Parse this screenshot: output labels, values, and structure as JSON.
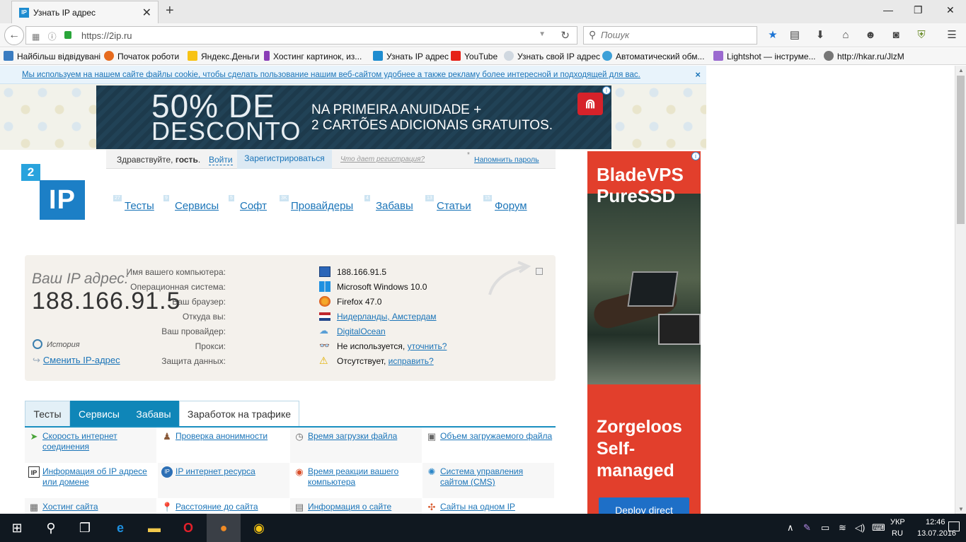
{
  "browser": {
    "tab_title": "Узнать IP адрес",
    "tab_favicon": "IP",
    "url": "https://2ip.ru",
    "search_placeholder": "Пошук",
    "bookmarks": [
      {
        "label": "Найбільш відвідувані",
        "icon": "most-visited-icon"
      },
      {
        "label": "Початок роботи",
        "icon": "firefox-icon"
      },
      {
        "label": "Яндекс.Деньги",
        "icon": "yandex-money-icon"
      },
      {
        "label": "Хостинг картинок, из...",
        "icon": "k-icon"
      },
      {
        "label": "Узнать IP адрес",
        "icon": "ip-icon"
      },
      {
        "label": "YouTube",
        "icon": "youtube-icon"
      },
      {
        "label": "Узнать свой IP адрес",
        "icon": "search-icon"
      },
      {
        "label": "Автоматический обм...",
        "icon": "exchange-icon"
      },
      {
        "label": "Lightshot — інструме...",
        "icon": "feather-icon"
      },
      {
        "label": "http://hkar.ru/JlzM",
        "icon": "globe-icon"
      }
    ]
  },
  "cookie": {
    "text": "Мы используем на нашем сайте файлы cookie, чтобы сделать пользование нашим веб-сайтом удобнее а также рекламу более интересной и подходящей для вас.",
    "close": "×"
  },
  "banner": {
    "line1": "50% DE",
    "line2": "DESCONTO",
    "text1": "NA PRIMEIRA ANUIDADE +",
    "text2": "2 CARTÕES ADICIONAIS GRATUITOS."
  },
  "login": {
    "greeting": "Здравствуйте,",
    "guest": "гость",
    "login": "Войти",
    "register": "Зарегистрироваться",
    "what": "Что дает регистрация?",
    "star": "*",
    "remind": "Напомнить пароль"
  },
  "logo": {
    "top": "2",
    "main": "IP"
  },
  "nav": [
    {
      "count": "27",
      "label": "Тесты"
    },
    {
      "count": "9",
      "label": "Сервисы"
    },
    {
      "count": "5",
      "label": "Софт"
    },
    {
      "count": "3K",
      "label": "Провайдеры"
    },
    {
      "count": "4",
      "label": "Забавы"
    },
    {
      "count": "13",
      "label": "Статьи"
    },
    {
      "count": "15",
      "label": "Форум"
    }
  ],
  "ipinfo": {
    "caption": "Ваш IP адрес:",
    "ip": "188.166.91.5",
    "history": "История",
    "change": "Сменить IP-адрес",
    "rows": [
      {
        "key": "Имя вашего компьютера:",
        "value": "188.166.91.5",
        "icon": "computer-icon"
      },
      {
        "key": "Операционная система:",
        "value": "Microsoft Windows 10.0",
        "icon": "windows-icon"
      },
      {
        "key": "Ваш браузер:",
        "value": "Firefox 47.0",
        "icon": "firefox-icon"
      },
      {
        "key": "Откуда вы:",
        "value": "Нидерланды, Амстердам",
        "icon": "netherlands-flag-icon"
      },
      {
        "key": "Ваш провайдер:",
        "value": "DigitalOcean",
        "icon": "cloud-icon"
      },
      {
        "key": "Прокси:",
        "value": "Не используется,",
        "extra": "уточнить?",
        "icon": "glasses-icon"
      },
      {
        "key": "Защита данных:",
        "value": "Отсутствует,",
        "extra": "исправить?",
        "icon": "warning-icon"
      }
    ]
  },
  "tabs": [
    "Тесты",
    "Сервисы",
    "Забавы",
    "Заработок на трафике"
  ],
  "services": [
    {
      "label": "Скорость интернет соединения",
      "icon": "speed-icon"
    },
    {
      "label": "Проверка анонимности",
      "icon": "spy-icon"
    },
    {
      "label": "Время загрузки файла",
      "icon": "clock-icon"
    },
    {
      "label": "Объем загружаемого файла",
      "icon": "file-size-icon"
    },
    {
      "label": "Информация об IP адресе или домене",
      "icon": "ip-info-icon"
    },
    {
      "label": "IP интернет ресурса",
      "icon": "ip-globe-icon"
    },
    {
      "label": "Время реакции вашего компьютера",
      "icon": "ping-icon"
    },
    {
      "label": "Система управления сайтом (CMS)",
      "icon": "cms-icon"
    },
    {
      "label": "Хостинг сайта",
      "icon": "hosting-icon"
    },
    {
      "label": "Расстояние до сайта",
      "icon": "location-pin-icon"
    },
    {
      "label": "Информация о сайте",
      "icon": "site-info-icon"
    },
    {
      "label": "Сайты на одном IP",
      "icon": "sites-icon"
    }
  ],
  "sidead": {
    "line1": "BladeVPS",
    "line2": "PureSSD",
    "z1": "Zorgeloos",
    "z2": "Self-",
    "z3": "managed",
    "cta": "Deploy direct"
  },
  "taskbar": {
    "lang1": "УКР",
    "lang2": "RU",
    "time": "12:46",
    "date": "13.07.2016"
  }
}
